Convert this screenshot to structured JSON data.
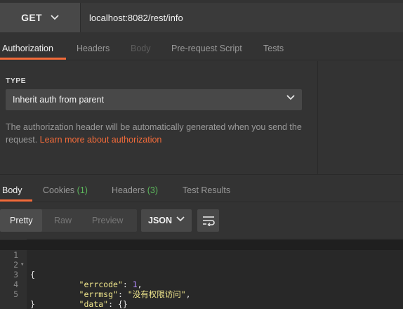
{
  "request": {
    "method": "GET",
    "url": "localhost:8082/rest/info"
  },
  "request_tabs": [
    "Authorization",
    "Headers",
    "Body",
    "Pre-request Script",
    "Tests"
  ],
  "auth": {
    "type_label": "TYPE",
    "type_value": "Inherit auth from parent",
    "description": "The authorization header will be automatically generated when you send the request.",
    "link_text": "Learn more about authorization"
  },
  "response_tabs": {
    "body": "Body",
    "cookies": "Cookies",
    "cookies_count": "(1)",
    "headers": "Headers",
    "headers_count": "(3)",
    "test_results": "Test Results"
  },
  "view_modes": [
    "Pretty",
    "Raw",
    "Preview"
  ],
  "format": "JSON",
  "code": {
    "line_numbers": [
      "1",
      "2",
      "3",
      "4",
      "5"
    ],
    "open_brace": "{",
    "close_brace": "}",
    "errcode_key": "\"errcode\"",
    "errcode_value": "1",
    "errmsg_key": "\"errmsg\"",
    "errmsg_value": "\"没有权限访问\"",
    "data_key": "\"data\"",
    "data_value": "{}"
  },
  "colors": {
    "accent": "#f26b3a",
    "count_green": "#5cb85c",
    "json_key": "#f0e68c",
    "json_number": "#b38cff"
  }
}
